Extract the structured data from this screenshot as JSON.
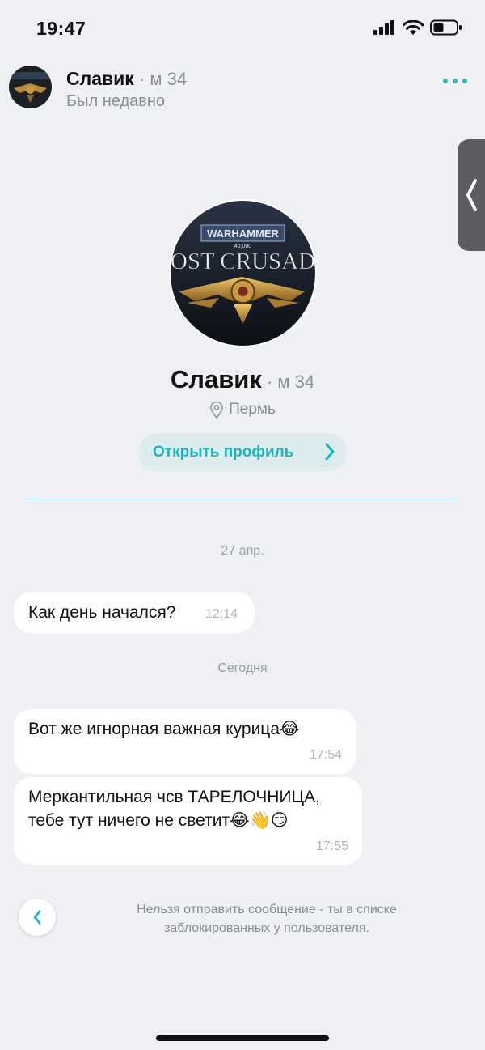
{
  "status_bar": {
    "time": "19:47"
  },
  "header": {
    "name": "Славик",
    "meta": "м 34",
    "status": "Был недавно"
  },
  "profile": {
    "avatar_text_top": "WARHAMMER",
    "avatar_text_sub": "40,000",
    "avatar_text_main": "OST CRUSAD",
    "name": "Славик",
    "meta": "м 34",
    "city": "Пермь",
    "open_profile_label": "Открыть профиль"
  },
  "chat": {
    "date_1": "27 апр.",
    "date_2": "Сегодня",
    "messages": [
      {
        "text": "Как день начался?",
        "time": "12:14"
      },
      {
        "text": "Вот же игнорная важная курица😂",
        "time": "17:54"
      },
      {
        "text": "Меркантильная чсв ТАРЕЛОЧНИЦА, тебе тут ничего не светит😂👋😏",
        "time": "17:55"
      }
    ]
  },
  "footer": {
    "blocked_note": "Нельзя отправить сообщение - ты в списке заблокированных у пользователя."
  },
  "colors": {
    "accent": "#2ab6be",
    "background": "#eff0f4",
    "bubble": "#ffffff"
  }
}
